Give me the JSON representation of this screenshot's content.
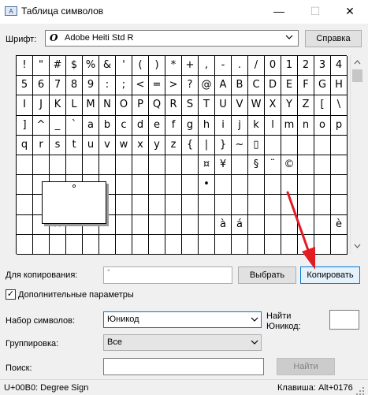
{
  "window": {
    "icon": "charmap-app-icon",
    "icon_glyph": "A",
    "title": "Таблица символов",
    "minimize_glyph": "—",
    "maximize_glyph": "☐",
    "close_glyph": "✕"
  },
  "font": {
    "label": "Шрифт:",
    "glyph": "O",
    "value": "Adobe Heiti Std R",
    "help_button": "Справка"
  },
  "grid": {
    "rows": [
      [
        "!",
        "\"",
        "#",
        "$",
        "%",
        "&",
        "'",
        "(",
        ")",
        "*",
        "+",
        ",",
        "-",
        ".",
        "/",
        "0",
        "1",
        "2",
        "3",
        "4"
      ],
      [
        "5",
        "6",
        "7",
        "8",
        "9",
        ":",
        ";",
        "<",
        "=",
        ">",
        "?",
        "@",
        "A",
        "B",
        "C",
        "D",
        "E",
        "F",
        "G",
        "H"
      ],
      [
        "I",
        "J",
        "K",
        "L",
        "M",
        "N",
        "O",
        "P",
        "Q",
        "R",
        "S",
        "T",
        "U",
        "V",
        "W",
        "X",
        "Y",
        "Z",
        "[",
        "\\"
      ],
      [
        "]",
        "^",
        "_",
        "`",
        "a",
        "b",
        "c",
        "d",
        "e",
        "f",
        "g",
        "h",
        "i",
        "j",
        "k",
        "l",
        "m",
        "n",
        "o",
        "p"
      ],
      [
        "q",
        "r",
        "s",
        "t",
        "u",
        "v",
        "w",
        "x",
        "y",
        "z",
        "{",
        "|",
        "}",
        "~",
        "▯",
        "",
        "",
        "",
        "",
        ""
      ],
      [
        "",
        "",
        "",
        "",
        "",
        "",
        "",
        "",
        "",
        "",
        "",
        "¤",
        "¥",
        "",
        "§",
        "¨",
        "©",
        "",
        "",
        ""
      ],
      [
        "",
        "",
        "",
        "",
        "",
        "",
        "",
        "",
        "",
        "",
        "",
        "•",
        "",
        "",
        "",
        "",
        "",
        "",
        "",
        ""
      ],
      [
        "",
        "",
        "",
        "",
        "",
        "",
        "",
        "",
        "",
        "",
        "",
        "",
        "",
        "",
        "",
        "",
        "",
        "",
        "",
        ""
      ],
      [
        "",
        "",
        "×",
        "",
        "",
        "",
        "",
        "",
        "",
        "",
        "",
        "",
        "à",
        "á",
        "",
        "",
        "",
        "",
        "",
        "è"
      ],
      [
        "",
        "",
        "",
        "",
        "",
        "",
        "",
        "",
        "",
        "",
        "",
        "",
        "",
        "",
        "",
        "",
        "",
        "",
        "",
        ""
      ]
    ],
    "zoom_glyph": "°"
  },
  "copy": {
    "label": "Для копирования:",
    "value": "°",
    "select_button": "Выбрать",
    "copy_button": "Копировать"
  },
  "advanced": {
    "checked": true,
    "check_glyph": "✓",
    "label": "Дополнительные параметры"
  },
  "charset": {
    "label": "Набор символов:",
    "value": "Юникод",
    "find_label": "Найти Юникод:",
    "find_value": ""
  },
  "grouping": {
    "label": "Группировка:",
    "value": "Все"
  },
  "search": {
    "label": "Поиск:",
    "value": "",
    "button": "Найти"
  },
  "status": {
    "left": "U+00B0: Degree Sign",
    "right": "Клавиша: Alt+0176"
  },
  "colors": {
    "annotation_arrow": "#e31b23",
    "focus_blue": "#0078d7"
  }
}
